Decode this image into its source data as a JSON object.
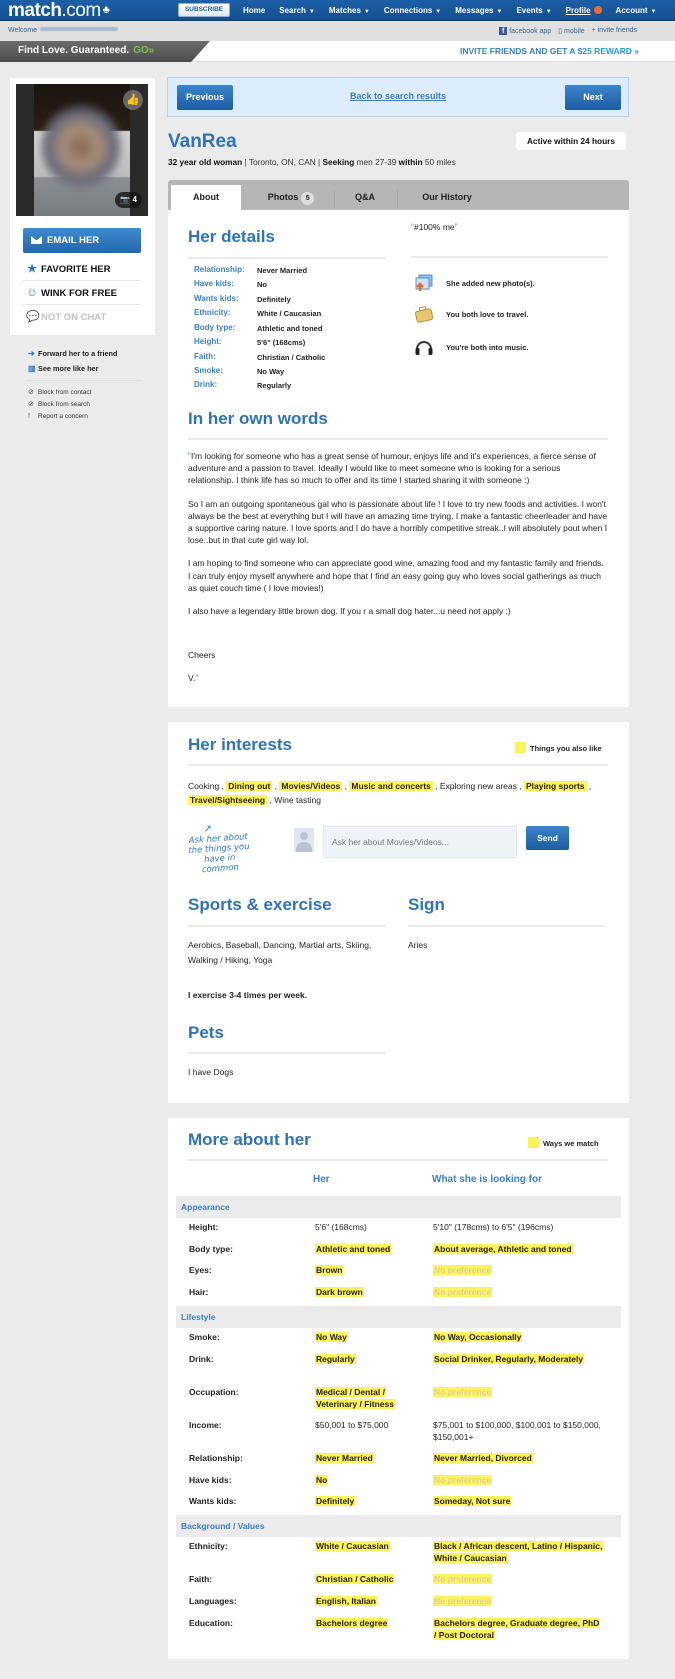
{
  "topnav": {
    "logo": "match",
    "logo_suffix": ".com",
    "subscribe": "SUBSCRIBE",
    "items": [
      {
        "label": "Home",
        "dropdown": false
      },
      {
        "label": "Search",
        "dropdown": true
      },
      {
        "label": "Matches",
        "dropdown": true
      },
      {
        "label": "Connections",
        "dropdown": true
      },
      {
        "label": "Messages",
        "dropdown": true
      },
      {
        "label": "Events",
        "dropdown": true
      },
      {
        "label": "Profile",
        "dropdown": false
      },
      {
        "label": "Account",
        "dropdown": true
      }
    ]
  },
  "welcomebar": {
    "welcome": "Welcome",
    "links": [
      "facebook app",
      "mobile",
      "invite friends"
    ]
  },
  "promo": {
    "left": "Find Love. Guaranteed.",
    "go": "GO»",
    "right_prefix": "INVITE FRIENDS AND GET A ",
    "right_reward": "$25 REWARD »"
  },
  "sidebar": {
    "photo_count": "4",
    "email": "EMAIL HER",
    "favorite": "FAVORITE HER",
    "wink": "WINK FOR FREE",
    "chat": "NOT ON CHAT",
    "links": [
      "Forward her to a friend",
      "See more like her"
    ],
    "small_links": [
      "Block from contact",
      "Block from search",
      "Report a concern"
    ]
  },
  "pager": {
    "previous": "Previous",
    "back": "Back to search results",
    "next": "Next"
  },
  "profile": {
    "username": "VanRea",
    "age_gender": "32 year old woman",
    "location": "Toronto, ON, CAN",
    "seeking_label": "Seeking",
    "seeking": "men 27-39",
    "within_label": "within",
    "distance": "50 miles",
    "active": "Active within 24 hours"
  },
  "tabs": [
    {
      "label": "About",
      "active": true
    },
    {
      "label": "Photos",
      "count": "5"
    },
    {
      "label": "Q&A"
    },
    {
      "label": "Our History"
    }
  ],
  "details": {
    "title": "Her details",
    "rows": [
      {
        "label": "Relationship:",
        "value": "Never Married"
      },
      {
        "label": "Have kids:",
        "value": "No"
      },
      {
        "label": "Wants kids:",
        "value": "Definitely"
      },
      {
        "label": "Ethnicity:",
        "value": "White / Caucasian"
      },
      {
        "label": "Body type:",
        "value": "Athletic and toned"
      },
      {
        "label": "Height:",
        "value": "5'6\" (168cms)"
      },
      {
        "label": "Faith:",
        "value": "Christian / Catholic"
      },
      {
        "label": "Smoke:",
        "value": "No Way"
      },
      {
        "label": "Drink:",
        "value": "Regularly"
      }
    ],
    "motto": "#100% me",
    "activity": [
      {
        "icon": "photo-upload-icon",
        "text": "She added new photo(s)."
      },
      {
        "icon": "suitcase-icon",
        "text": "You both love to travel."
      },
      {
        "icon": "headphones-icon",
        "text": "You're both into music."
      }
    ]
  },
  "own_words": {
    "title": "In her own words",
    "paragraphs": [
      "I'm looking for someone who has a great sense of humour, enjoys life and it's experiences, a fierce sense of adventure and a passion to travel. Ideally I would like to meet someone who is looking for a serious relationship. I think life has so much to offer and its time I started sharing it with someone :)",
      "So I am an outgoing spontaneous gal who is passionate about life ! I love to try new foods and activities. I won't always be the best at everything but I will have an amazing time trying.  I make a fantastic cheerleader and have a supportive caring nature. I love sports and I do have a horribly competitive streak..I will absolutely pout when I lose..but in that cute girl way lol.",
      "I am hoping to find someone who can appreciate good wine, amazing food and my fantastic family and friends. I can truly enjoy myself anywhere and hope that I find an easy going guy who loves social gatherings as much as quiet couch time ( I love movies!)",
      "I also have a legendary little brown dog. If you r a small dog hater...u need not apply :)",
      "",
      "Cheers",
      "V."
    ]
  },
  "interests": {
    "title": "Her interests",
    "legend": "Things you also like",
    "items": [
      {
        "label": "Cooking",
        "match": false
      },
      {
        "label": "Dining out",
        "match": true
      },
      {
        "label": "Movies/Videos",
        "match": true
      },
      {
        "label": "Music and concerts",
        "match": true
      },
      {
        "label": "Exploring new areas",
        "match": false
      },
      {
        "label": "Playing sports",
        "match": true
      },
      {
        "label": "Travel/Sightseeing",
        "match": true
      },
      {
        "label": "Wine tasting",
        "match": false
      }
    ],
    "prompt": "Ask her about the things you have in common",
    "input_placeholder": "Ask her about Movies/Videos...",
    "send": "Send",
    "sports_title": "Sports & exercise",
    "sports": "Aerobics, Baseball, Dancing, Martial arts, Skiing, Walking / Hiking, Yoga",
    "exercise": "I exercise 3-4 times per week.",
    "sign_title": "Sign",
    "sign": "Aries",
    "pets_title": "Pets",
    "pets": "I have Dogs"
  },
  "more": {
    "title": "More about her",
    "legend": "Ways we match",
    "col_her": "Her",
    "col_seek": "What she is looking for",
    "sections": [
      {
        "name": "Appearance",
        "rows": [
          {
            "label": "Height:",
            "her": "5'6\" (168cms)",
            "her_match": false,
            "seek": "5'10\" (178cms) to 6'5\" (196cms)",
            "seek_match": false
          },
          {
            "label": "Body type:",
            "her": "Athletic and toned",
            "her_match": true,
            "seek": "About average, Athletic and toned",
            "seek_match": true
          },
          {
            "label": "Eyes:",
            "her": "Brown",
            "her_match": true,
            "seek": "No preference",
            "seek_match": "nopref"
          },
          {
            "label": "Hair:",
            "her": "Dark brown",
            "her_match": true,
            "seek": "No preference",
            "seek_match": "nopref"
          }
        ]
      },
      {
        "name": "Lifestyle",
        "rows": [
          {
            "label": "Smoke:",
            "her": "No Way",
            "her_match": true,
            "seek": "No Way, Occasionally",
            "seek_match": true
          },
          {
            "label": "Drink:",
            "her": "Regularly",
            "her_match": true,
            "seek": "Social Drinker, Regularly, Moderately",
            "seek_match": true
          },
          {
            "label": "Occupation:",
            "her": "Medical / Dental / Veterinary / Fitness",
            "her_match": true,
            "seek": "No preference",
            "seek_match": "nopref"
          },
          {
            "label": "Income:",
            "her": "$50,001 to $75,000",
            "her_match": false,
            "seek": "$75,001 to $100,000, $100,001 to $150,000, $150,001+",
            "seek_match": false
          },
          {
            "label": "Relationship:",
            "her": "Never Married",
            "her_match": true,
            "seek": "Never Married, Divorced",
            "seek_match": true
          },
          {
            "label": "Have kids:",
            "her": "No",
            "her_match": true,
            "seek": "No preference",
            "seek_match": "nopref"
          },
          {
            "label": "Wants kids:",
            "her": "Definitely",
            "her_match": true,
            "seek": "Someday, Not sure",
            "seek_match": true
          }
        ]
      },
      {
        "name": "Background / Values",
        "rows": [
          {
            "label": "Ethnicity:",
            "her": "White / Caucasian",
            "her_match": true,
            "seek": "Black / African descent, Latino / Hispanic, White / Caucasian",
            "seek_match": true
          },
          {
            "label": "Faith:",
            "her": "Christian / Catholic",
            "her_match": true,
            "seek": "No preference",
            "seek_match": "nopref"
          },
          {
            "label": "Languages:",
            "her": "English, Italian",
            "her_match": true,
            "seek": "No preference",
            "seek_match": "nopref"
          },
          {
            "label": "Education:",
            "her": "Bachelors degree",
            "her_match": true,
            "seek": "Bachelors degree, Graduate degree, PhD / Post Doctoral",
            "seek_match": true
          }
        ]
      }
    ]
  },
  "colors": {
    "brand_blue": "#1d5fa8",
    "heading_blue": "#2e73b8",
    "highlight_yellow": "#fff35c",
    "go_green": "#7ac142"
  }
}
